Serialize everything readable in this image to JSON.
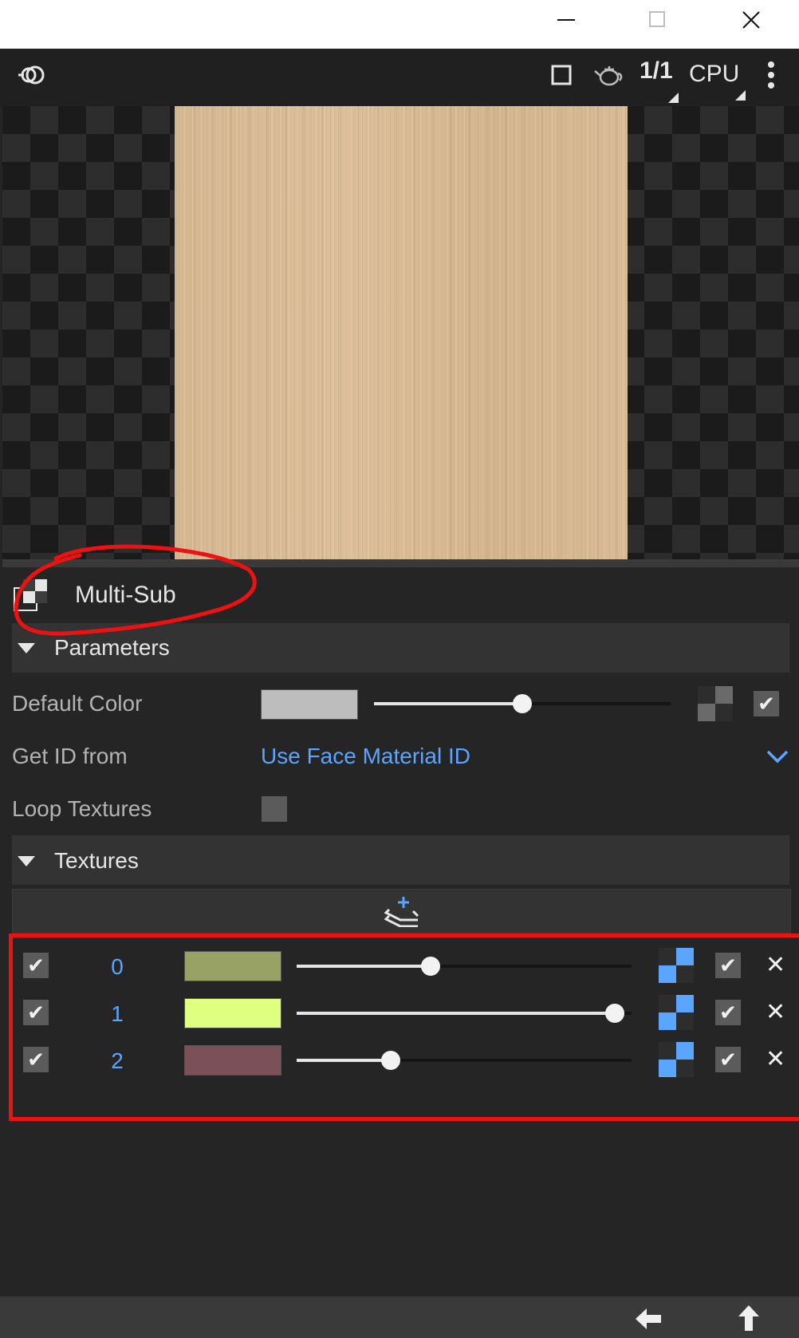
{
  "window": {
    "minimize_icon": "minimize-icon",
    "maximize_icon": "maximize-icon",
    "close_icon": "close-icon"
  },
  "toolbar": {
    "ratio_label": "1/1",
    "render_mode": "CPU"
  },
  "node": {
    "title": "Multi-Sub"
  },
  "parameters": {
    "section_title": "Parameters",
    "default_color": {
      "label": "Default Color",
      "swatch_color": "#bdbdbd",
      "amount": 0.5
    },
    "get_id_from": {
      "label": "Get ID from",
      "value": "Use Face Material ID"
    },
    "loop_textures": {
      "label": "Loop Textures",
      "checked": false
    }
  },
  "textures": {
    "section_title": "Textures",
    "rows": [
      {
        "index": "0",
        "color": "#98a264",
        "amount": 0.4
      },
      {
        "index": "1",
        "color": "#deff80",
        "amount": 0.95
      },
      {
        "index": "2",
        "color": "#7b5058",
        "amount": 0.28
      }
    ]
  },
  "colors": {
    "accent": "#5aa5ff",
    "annotation": "#ee1111"
  }
}
